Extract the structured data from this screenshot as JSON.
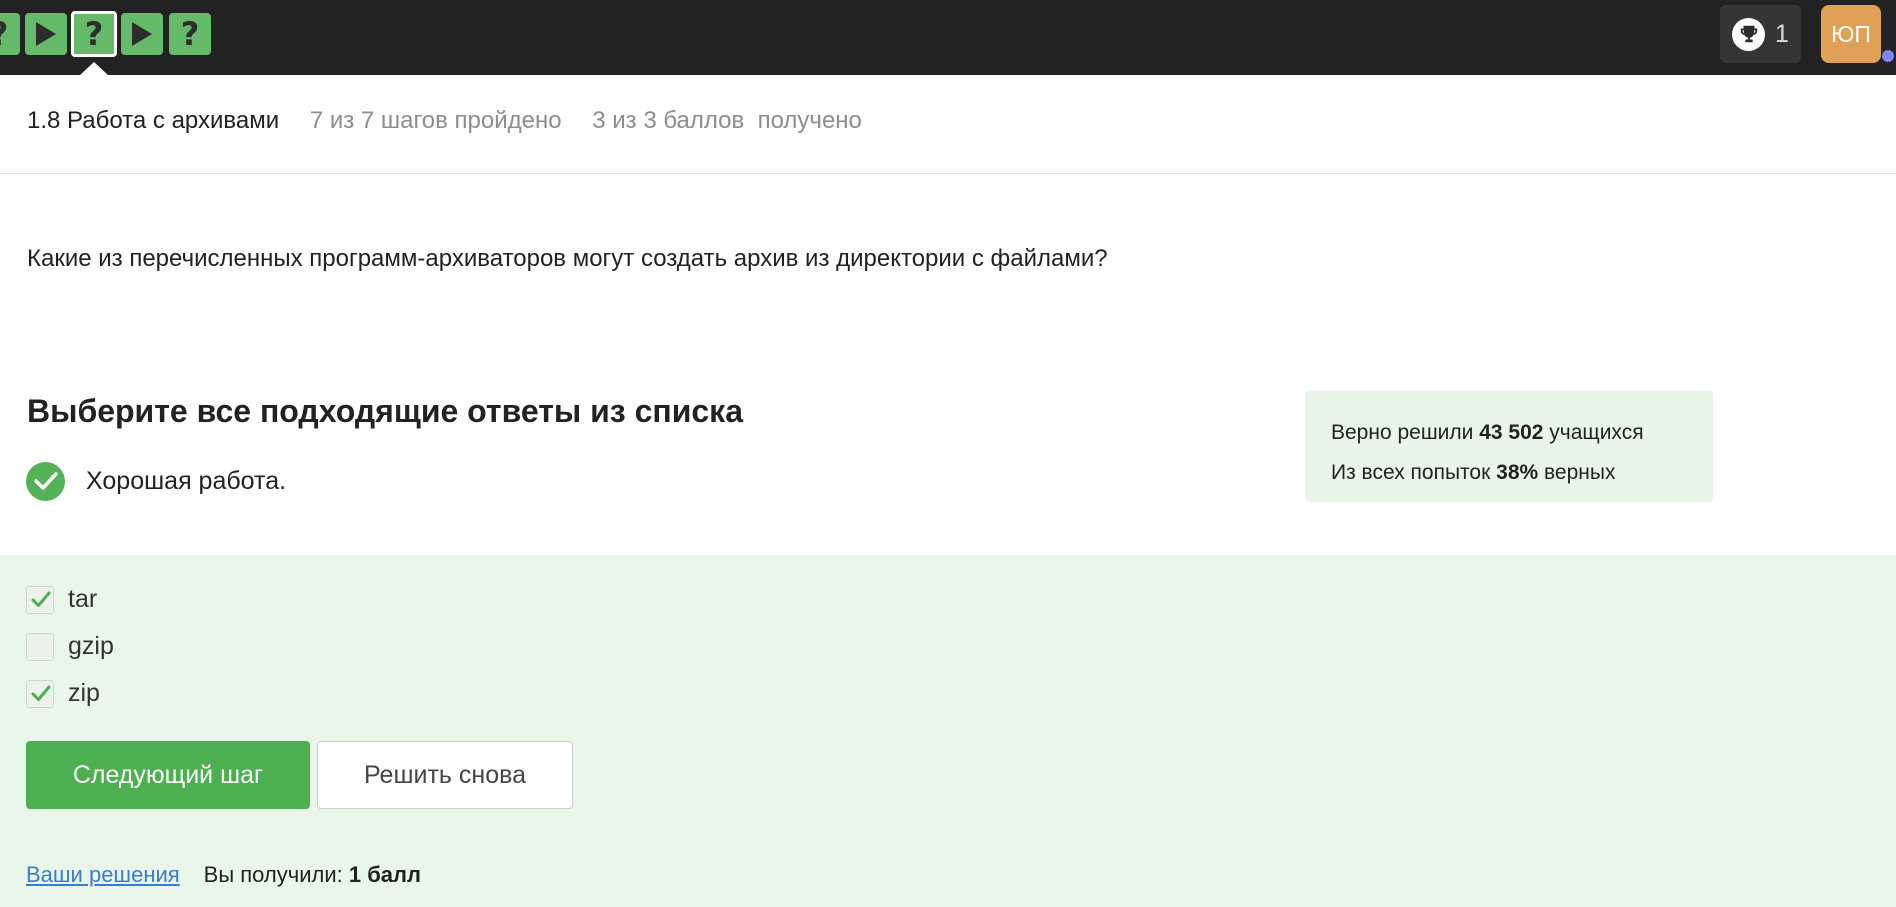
{
  "steps": [
    {
      "kind": "quiz",
      "glyph": "?",
      "current": false
    },
    {
      "kind": "video",
      "glyph": "play-icon",
      "current": false
    },
    {
      "kind": "quiz",
      "glyph": "?",
      "current": true
    },
    {
      "kind": "video",
      "glyph": "play-icon",
      "current": false
    },
    {
      "kind": "quiz",
      "glyph": "?",
      "current": false
    }
  ],
  "topbar": {
    "trophy_count": "1",
    "avatar_initials": "ЮП"
  },
  "header": {
    "lesson_title": "1.8 Работа с архивами",
    "steps_progress": "7 из 7 шагов пройдено",
    "score_progress": "3 из 3 баллов  получено"
  },
  "question": {
    "text": "Какие из перечисленных программ-архиваторов могут создать архив из директории с файлами?"
  },
  "task": {
    "title": "Выберите все подходящие ответы из списка",
    "feedback": "Хорошая работа."
  },
  "stats": {
    "solved_prefix": "Верно решили ",
    "solved_count": "43 502",
    "solved_suffix": " учащихся",
    "attempts_prefix": "Из всех попыток ",
    "attempts_percent": "38%",
    "attempts_suffix": " верных"
  },
  "options": [
    {
      "label": "tar",
      "checked": true
    },
    {
      "label": "gzip",
      "checked": false
    },
    {
      "label": "zip",
      "checked": true
    }
  ],
  "buttons": {
    "next": "Следующий шаг",
    "retry": "Решить снова"
  },
  "footer": {
    "solutions_link": "Ваши решения",
    "result_prefix": "Вы получили: ",
    "result_value": "1 балл"
  },
  "colors": {
    "topbar": "#222222",
    "step_green": "#66bb6a",
    "primary_green": "#4caf50",
    "answer_bg": "#e8f7ea",
    "avatar": "#e0a055",
    "link": "#3a7bd5"
  }
}
